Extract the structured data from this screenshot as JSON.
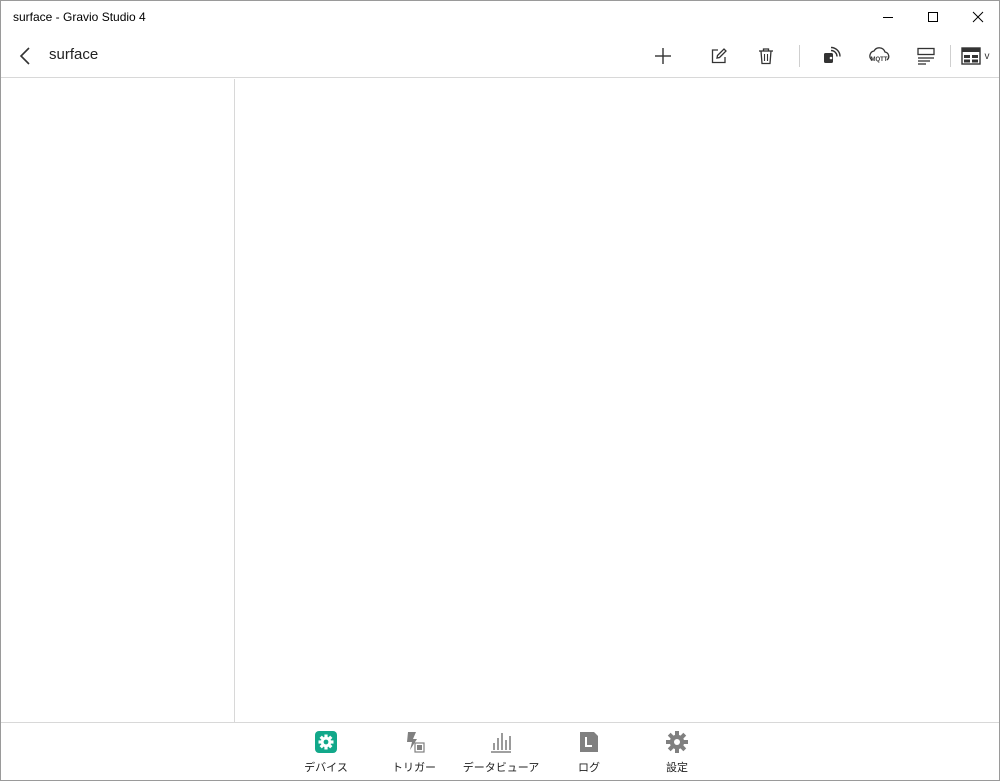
{
  "window": {
    "title": "surface - Gravio Studio 4"
  },
  "header": {
    "page_title": "surface"
  },
  "toolbar": {
    "icons": [
      "back-icon",
      "add-icon",
      "edit-icon",
      "delete-icon",
      "beacon-icon",
      "mqtt-icon",
      "list-icon",
      "layout-icon",
      "chevron-down-icon"
    ],
    "mqtt_label": "MQTT",
    "layout_chevron": "v"
  },
  "bottom_nav": {
    "items": [
      {
        "label": "デバイス",
        "icon": "device-gear-icon",
        "active": true
      },
      {
        "label": "トリガー",
        "icon": "trigger-icon",
        "active": false
      },
      {
        "label": "データビューア",
        "icon": "bar-chart-icon",
        "active": false
      },
      {
        "label": "ログ",
        "icon": "log-document-icon",
        "active": false
      },
      {
        "label": "設定",
        "icon": "settings-gear-icon",
        "active": false
      }
    ]
  },
  "colors": {
    "accent": "#12a88a",
    "icon_gray": "#808080",
    "border": "#d8d8d8"
  }
}
